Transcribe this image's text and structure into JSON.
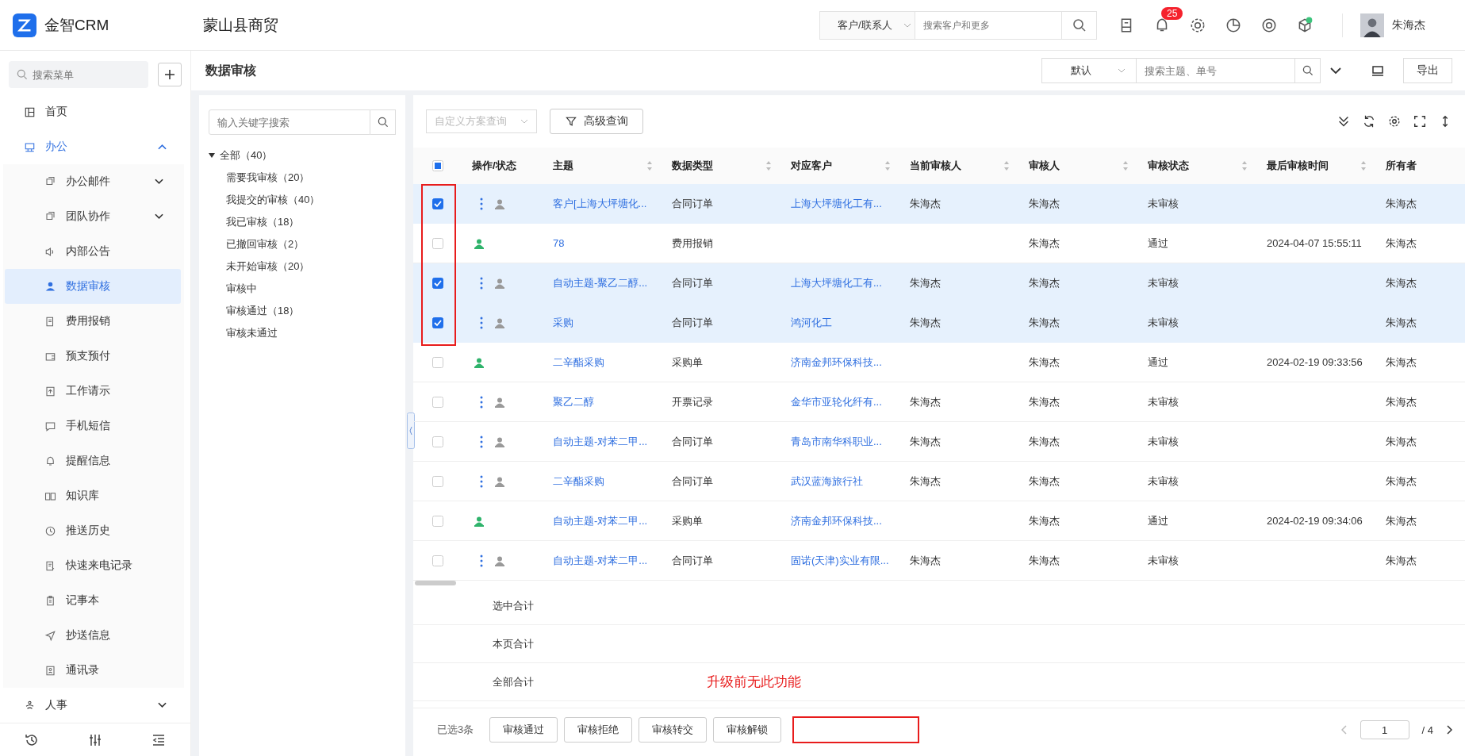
{
  "app": {
    "logo_text": "金智CRM",
    "company": "蒙山县商贸",
    "search_scope": "客户/联系人",
    "search_placeholder": "搜索客户和更多",
    "notification_count": "25",
    "user_name": "朱海杰"
  },
  "sidebar": {
    "search_placeholder": "搜索菜单",
    "items": [
      {
        "label": "首页",
        "expandable": false,
        "expanded": false
      },
      {
        "label": "办公",
        "expandable": true,
        "expanded": true,
        "children": [
          {
            "label": "办公邮件",
            "expandable": true,
            "selected": false
          },
          {
            "label": "团队协作",
            "expandable": true,
            "selected": false
          },
          {
            "label": "内部公告",
            "expandable": false,
            "selected": false
          },
          {
            "label": "数据审核",
            "expandable": false,
            "selected": true
          },
          {
            "label": "费用报销",
            "expandable": false,
            "selected": false
          },
          {
            "label": "预支预付",
            "expandable": false,
            "selected": false
          },
          {
            "label": "工作请示",
            "expandable": false,
            "selected": false
          },
          {
            "label": "手机短信",
            "expandable": false,
            "selected": false
          },
          {
            "label": "提醒信息",
            "expandable": false,
            "selected": false
          },
          {
            "label": "知识库",
            "expandable": false,
            "selected": false
          },
          {
            "label": "推送历史",
            "expandable": false,
            "selected": false
          },
          {
            "label": "快速来电记录",
            "expandable": false,
            "selected": false
          },
          {
            "label": "记事本",
            "expandable": false,
            "selected": false
          },
          {
            "label": "抄送信息",
            "expandable": false,
            "selected": false
          },
          {
            "label": "通讯录",
            "expandable": false,
            "selected": false
          }
        ]
      },
      {
        "label": "人事",
        "expandable": true,
        "expanded": false
      }
    ]
  },
  "page": {
    "title": "数据审核",
    "view_select": "默认",
    "search_placeholder": "搜索主题、单号",
    "export_label": "导出"
  },
  "tree": {
    "search_placeholder": "输入关键字搜索",
    "root": {
      "label": "全部（40）",
      "expanded": true,
      "children": [
        {
          "label": "需要我审核（20）"
        },
        {
          "label": "我提交的审核（40）"
        },
        {
          "label": "我已审核（18）"
        },
        {
          "label": "已撤回审核（2）"
        },
        {
          "label": "未开始审核（20）"
        },
        {
          "label": "审核中"
        },
        {
          "label": "审核通过（18）"
        },
        {
          "label": "审核未通过"
        }
      ]
    }
  },
  "toolbar": {
    "scheme_placeholder": "自定义方案查询",
    "advanced_label": "高级查询"
  },
  "table": {
    "select_all": {
      "checked": false,
      "indeterminate": true
    },
    "selection_marked": true,
    "columns": [
      {
        "label": "操作/状态",
        "sortable": false
      },
      {
        "label": "主题",
        "sortable": true
      },
      {
        "label": "数据类型",
        "sortable": true
      },
      {
        "label": "对应客户",
        "sortable": true
      },
      {
        "label": "当前审核人",
        "sortable": true
      },
      {
        "label": "审核人",
        "sortable": true
      },
      {
        "label": "审核状态",
        "sortable": true
      },
      {
        "label": "最后审核时间",
        "sortable": true
      },
      {
        "label": "所有者",
        "sortable": false
      }
    ],
    "rows": [
      {
        "selected": true,
        "kind": "pending",
        "title": "客户[上海大坪塘化...",
        "type": "合同订单",
        "customer": "上海大坪塘化工有...",
        "current_reviewer": "朱海杰",
        "reviewer": "朱海杰",
        "status": "未审核",
        "owner": "朱海杰"
      },
      {
        "selected": false,
        "kind": "approved",
        "title": "78",
        "type": "费用报销",
        "reviewer": "朱海杰",
        "status": "通过",
        "last_time": "2024-04-07 15:55:11",
        "owner": "朱海杰"
      },
      {
        "selected": true,
        "kind": "pending",
        "title": "自动主题-聚乙二醇...",
        "type": "合同订单",
        "customer": "上海大坪塘化工有...",
        "current_reviewer": "朱海杰",
        "reviewer": "朱海杰",
        "status": "未审核",
        "owner": "朱海杰"
      },
      {
        "selected": true,
        "kind": "pending",
        "title": "采购",
        "type": "合同订单",
        "customer": "鸿河化工",
        "current_reviewer": "朱海杰",
        "reviewer": "朱海杰",
        "status": "未审核",
        "owner": "朱海杰"
      },
      {
        "selected": false,
        "kind": "approved",
        "title": "二辛酯采购",
        "type": "采购单",
        "customer": "济南金邦环保科技...",
        "reviewer": "朱海杰",
        "status": "通过",
        "last_time": "2024-02-19 09:33:56",
        "owner": "朱海杰"
      },
      {
        "selected": false,
        "kind": "pending",
        "title": "聚乙二醇",
        "type": "开票记录",
        "customer": "金华市亚轮化纤有...",
        "current_reviewer": "朱海杰",
        "reviewer": "朱海杰",
        "status": "未审核",
        "owner": "朱海杰"
      },
      {
        "selected": false,
        "kind": "pending",
        "title": "自动主题-对苯二甲...",
        "type": "合同订单",
        "customer": "青岛市南华科职业...",
        "current_reviewer": "朱海杰",
        "reviewer": "朱海杰",
        "status": "未审核",
        "owner": "朱海杰"
      },
      {
        "selected": false,
        "kind": "pending",
        "title": "二辛酯采购",
        "type": "合同订单",
        "customer": "武汉蓝海旅行社",
        "current_reviewer": "朱海杰",
        "reviewer": "朱海杰",
        "status": "未审核",
        "owner": "朱海杰"
      },
      {
        "selected": false,
        "kind": "approved",
        "title": "自动主题-对苯二甲...",
        "type": "采购单",
        "customer": "济南金邦环保科技...",
        "reviewer": "朱海杰",
        "status": "通过",
        "last_time": "2024-02-19 09:34:06",
        "owner": "朱海杰"
      },
      {
        "selected": false,
        "kind": "pending",
        "title": "自动主题-对苯二甲...",
        "type": "合同订单",
        "customer": "固诺(天津)实业有限...",
        "current_reviewer": "朱海杰",
        "reviewer": "朱海杰",
        "status": "未审核",
        "owner": "朱海杰"
      }
    ],
    "summary_rows": [
      "选中合计",
      "本页合计",
      "全部合计"
    ]
  },
  "annotation": {
    "text": "升级前无此功能",
    "empty_box": true
  },
  "footer": {
    "selected_count": "已选3条",
    "actions": [
      "审核通过",
      "审核拒绝",
      "审核转交",
      "审核解锁"
    ],
    "page": "1",
    "total_pages": "/ 4"
  }
}
